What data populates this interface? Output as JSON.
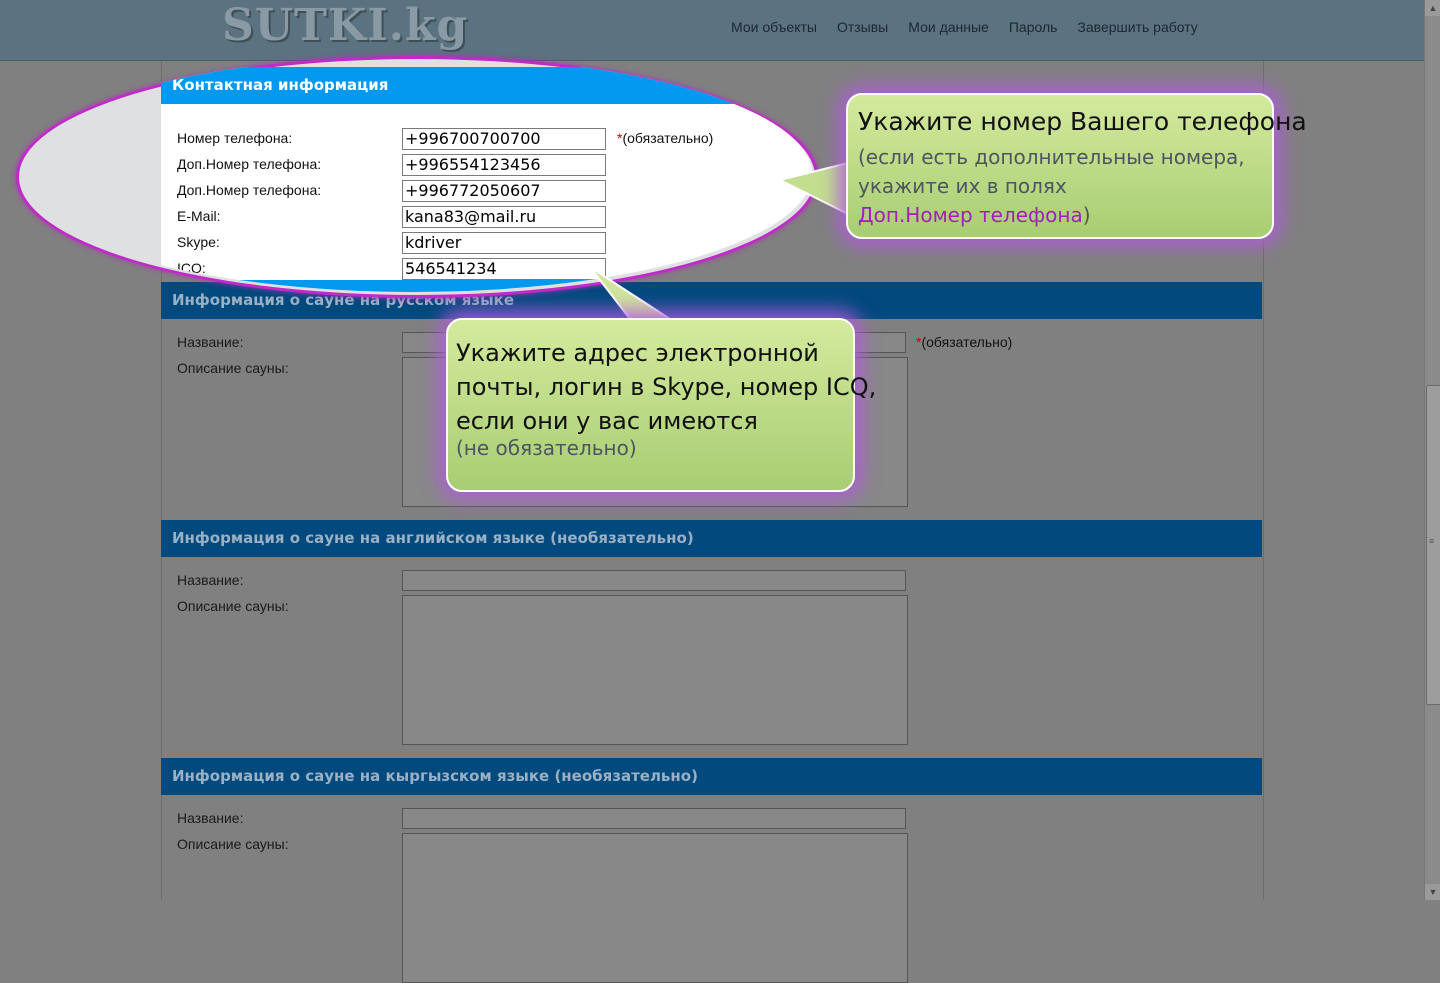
{
  "header": {
    "logo_text": "SUTKI.kg",
    "nav": [
      "Мои объекты",
      "Отзывы",
      "Мои данные",
      "Пароль",
      "Завершить работу"
    ]
  },
  "contact_section": {
    "title": "Контактная информация",
    "fields": [
      {
        "label": "Номер телефона:",
        "value": "+996700700700"
      },
      {
        "label": "Доп.Номер телефона:",
        "value": "+996554123456"
      },
      {
        "label": "Доп.Номер телефона:",
        "value": "+996772050607"
      },
      {
        "label": "E-Mail:",
        "value": "kana83@mail.ru"
      },
      {
        "label": "Skype:",
        "value": "kdriver"
      },
      {
        "label": "ICQ:",
        "value": "546541234"
      }
    ],
    "required_mark": "*",
    "required_text": "(обязательно)"
  },
  "sections": [
    {
      "title": "Информация о сауне на русском языке",
      "name_label": "Название:",
      "desc_label": "Описание сауны:",
      "name_value": "",
      "desc_value": ""
    },
    {
      "title": "Информация о сауне на английском языке (необязательно)",
      "name_label": "Название:",
      "desc_label": "Описание сауны:",
      "name_value": "",
      "desc_value": ""
    },
    {
      "title": "Информация о сауне на кыргызском языке (необязательно)",
      "name_label": "Название:",
      "desc_label": "Описание сауны:",
      "name_value": "",
      "desc_value": ""
    }
  ],
  "callouts": {
    "phone": {
      "line1": "Укажите номер Вашего телефона",
      "line2": "(если есть дополнительные номера,",
      "line3": "укажите их в полях",
      "highlight": "Доп.Номер телефона",
      "close": ")"
    },
    "email": {
      "line1": "Укажите адрес электронной",
      "line2": "почты, логин в Skype, номер ICQ,",
      "line3": "если они у вас имеются",
      "note": "(не обязательно)"
    }
  },
  "colors": {
    "section_header": "#02497d",
    "highlight_header": "#0399f0",
    "ellipse_border": "#c02ac8",
    "callout_green": "#b8d887",
    "callout_purple_text": "#a020b8"
  }
}
